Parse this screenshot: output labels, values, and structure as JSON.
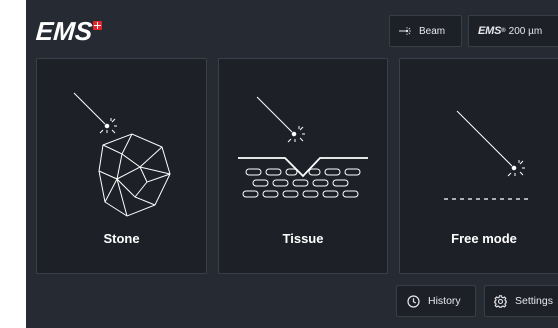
{
  "header": {
    "logo_text": "EMS",
    "logo_mark": "swiss-cross",
    "beam_button": {
      "icon": "beam-icon",
      "label": "Beam"
    },
    "fiber_button": {
      "brand": "EMS",
      "brand_sup": "®",
      "value": "200 µm"
    }
  },
  "modes": [
    {
      "label": "Stone",
      "illustration": "stone-illustration"
    },
    {
      "label": "Tissue",
      "illustration": "tissue-illustration"
    },
    {
      "label": "Free mode",
      "illustration": "free-mode-illustration"
    }
  ],
  "footer": {
    "history_button": {
      "icon": "clock-icon",
      "label": "History"
    },
    "settings_button": {
      "icon": "gear-icon",
      "label": "Settings"
    }
  },
  "colors": {
    "background": "#262a33",
    "card": "#1d2027",
    "card_border": "#3a3f4a",
    "logo_accent": "#e3262e",
    "text": "#ffffff"
  }
}
